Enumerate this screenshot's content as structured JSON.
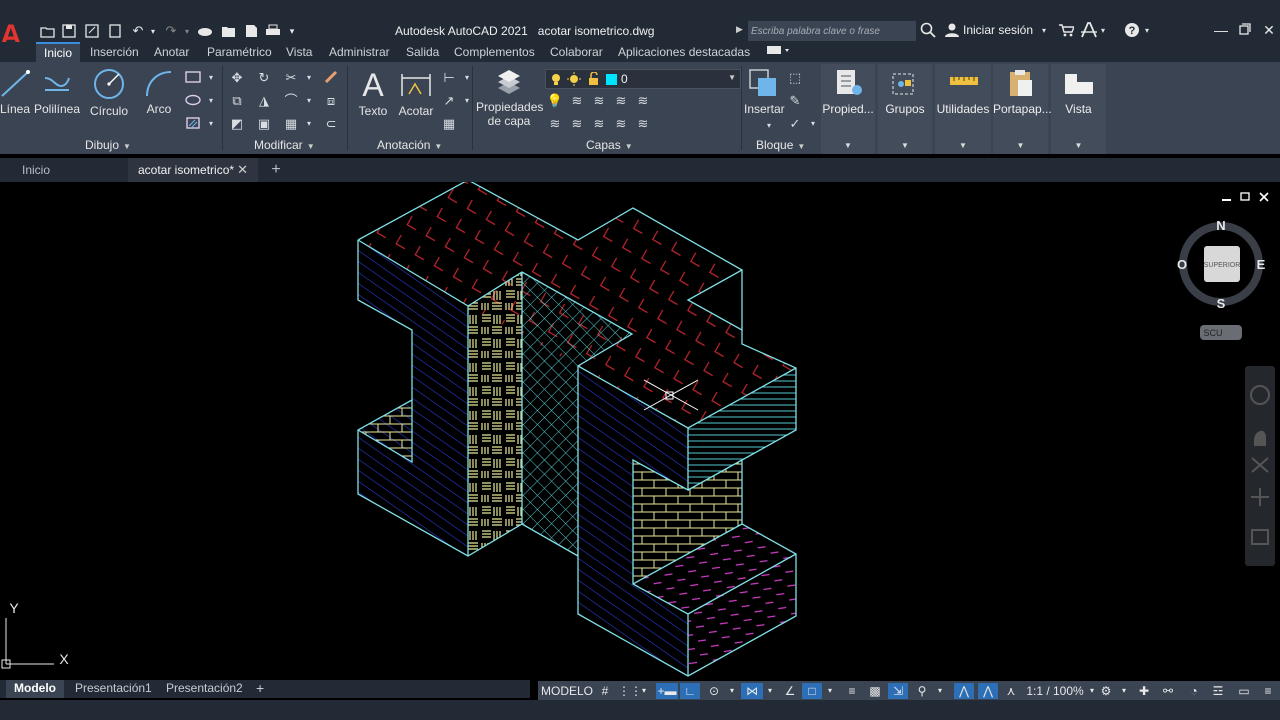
{
  "app": {
    "title": "Autodesk AutoCAD 2021",
    "file": "acotar isometrico.dwg",
    "logo_letter": "A",
    "search_placeholder": "Escriba palabra clave o frase",
    "signin": "Iniciar sesión"
  },
  "ribbon_tabs": [
    "Inicio",
    "Inserción",
    "Anotar",
    "Paramétrico",
    "Vista",
    "Administrar",
    "Salida",
    "Complementos",
    "Colaborar",
    "Aplicaciones destacadas"
  ],
  "ribbon": {
    "dibujo_tools": [
      "Línea",
      "Polilínea",
      "Círculo",
      "Arco"
    ],
    "anotacion_tools": [
      "Texto",
      "Acotar"
    ],
    "layer_props_line1": "Propiedades",
    "layer_props_line2": "de capa",
    "layer_current": "0",
    "insert": "Insertar",
    "dropdowns": [
      "Propied...",
      "Grupos",
      "Utilidades",
      "Portapap...",
      "Vista"
    ],
    "panels": {
      "dibujo": "Dibujo",
      "modificar": "Modificar",
      "anotacion": "Anotación",
      "capas": "Capas",
      "bloque": "Bloque"
    }
  },
  "file_tabs": {
    "home": "Inicio",
    "drawing": "acotar isometrico*"
  },
  "viewcube": {
    "north": "N",
    "south": "S",
    "east": "E",
    "west": "O",
    "face": "SUPERIOR",
    "ucs": "SCU"
  },
  "ucs_icon": {
    "x": "X",
    "y": "Y"
  },
  "layout_tabs": [
    "Modelo",
    "Presentación1",
    "Presentación2"
  ],
  "status": {
    "mode": "MODELO",
    "scale": "1:1 / 100%"
  },
  "colors": {
    "outline": "#7fe0e6",
    "hatch_red": "#c0262e",
    "hatch_blue": "#2b3ad0",
    "hatch_yellow": "#e8e89a",
    "hatch_cyan": "#56c8cf",
    "hatch_magenta": "#d040c8",
    "ribbon_bg": "#3b4453",
    "title_bg": "#222a35"
  }
}
